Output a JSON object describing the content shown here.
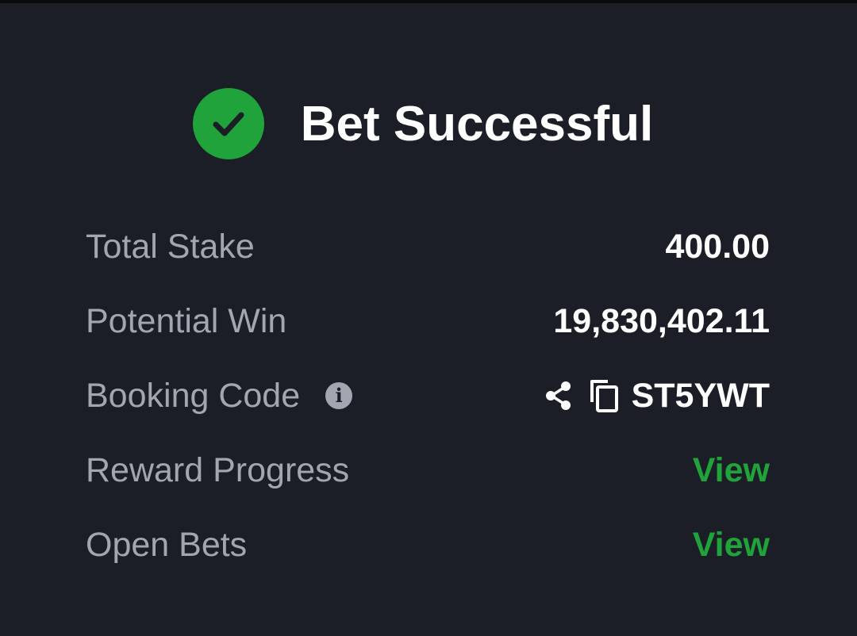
{
  "header": {
    "title": "Bet Successful",
    "status_icon": "check-circle-icon"
  },
  "colors": {
    "background": "#1b1e26",
    "accent_green": "#1fa33a",
    "label_gray": "#a2a6b0",
    "value_white": "#ffffff"
  },
  "summary": {
    "total_stake": {
      "label": "Total Stake",
      "value": "400.00"
    },
    "potential_win": {
      "label": "Potential Win",
      "value": "19,830,402.11"
    },
    "booking_code": {
      "label": "Booking Code",
      "info_icon": "info-icon",
      "share_icon": "share-icon",
      "copy_icon": "copy-icon",
      "value": "ST5YWT"
    },
    "reward_progress": {
      "label": "Reward Progress",
      "link": "View"
    },
    "open_bets": {
      "label": "Open Bets",
      "link": "View"
    }
  }
}
